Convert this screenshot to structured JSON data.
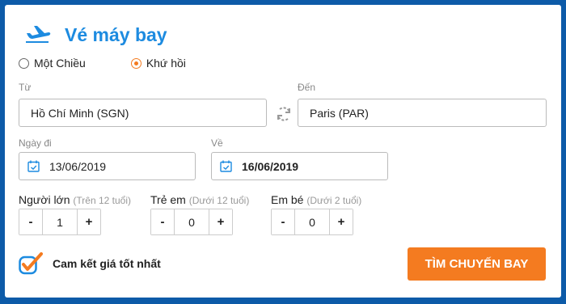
{
  "title": "Vé máy bay",
  "trip_type": {
    "one_way": "Một Chiều",
    "round_trip": "Khứ hồi",
    "selected": "round_trip"
  },
  "from": {
    "label": "Từ",
    "value": "Hồ Chí Minh (SGN)"
  },
  "to": {
    "label": "Đến",
    "value": "Paris (PAR)"
  },
  "depart": {
    "label": "Ngày đi",
    "value": "13/06/2019"
  },
  "return": {
    "label": "Về",
    "value": "16/06/2019"
  },
  "passengers": {
    "adults": {
      "label": "Người lớn",
      "hint": "(Trên 12 tuổi)",
      "value": "1"
    },
    "children": {
      "label": "Trẻ em",
      "hint": "(Dưới 12 tuổi)",
      "value": "0"
    },
    "infants": {
      "label": "Em bé",
      "hint": "(Dưới 2 tuổi)",
      "value": "0"
    },
    "minus": "-",
    "plus": "+"
  },
  "promise_text": "Cam kết giá tốt nhất",
  "search_button": "TÌM CHUYẾN BAY",
  "colors": {
    "accent": "#1d8be0",
    "orange": "#f47b20",
    "background": "#0d5ba8"
  }
}
